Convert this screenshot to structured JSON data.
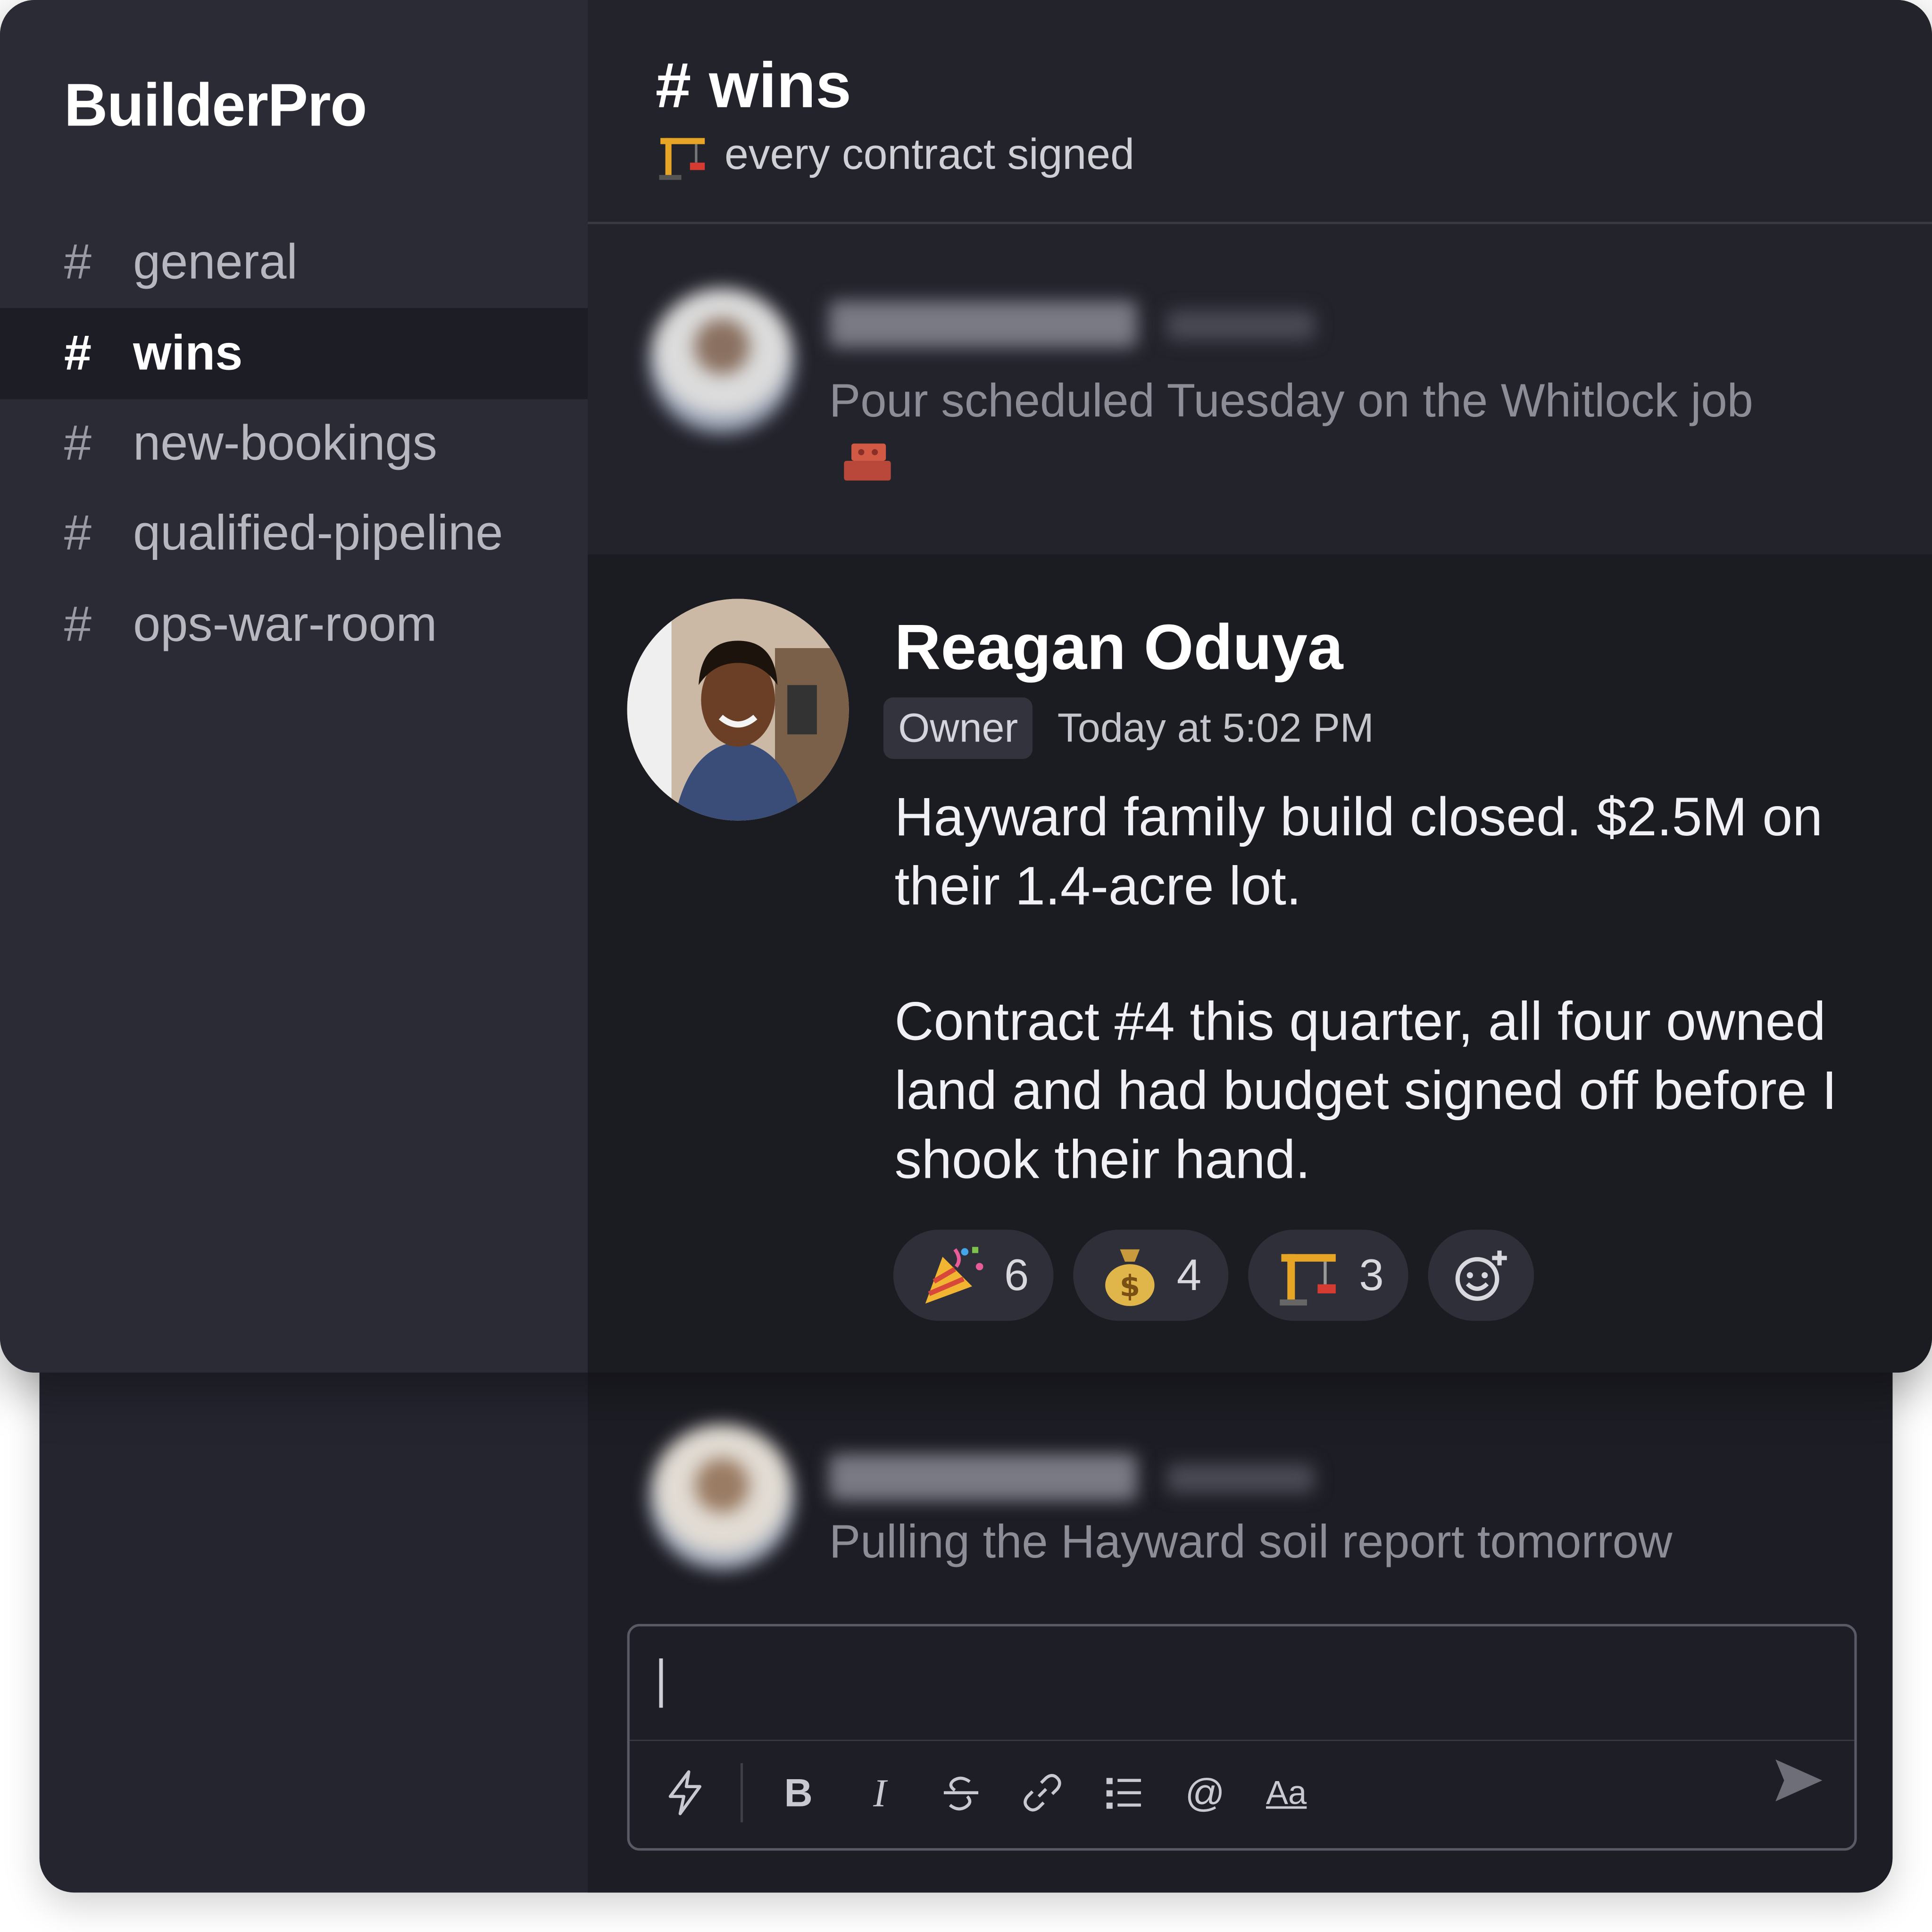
{
  "app": {
    "name": "BuilderPro"
  },
  "sidebar": {
    "channels": [
      {
        "label": "general",
        "active": false
      },
      {
        "label": "wins",
        "active": true
      },
      {
        "label": "new-bookings",
        "active": false
      },
      {
        "label": "qualified-pipeline",
        "active": false
      },
      {
        "label": "ops-war-room",
        "active": false
      }
    ],
    "hash_symbol": "#"
  },
  "channel": {
    "title": "# wins",
    "topic_icon": "construction-crane-icon",
    "topic": "every contract signed"
  },
  "messages": {
    "previous": {
      "text": "Pour scheduled Tuesday on the Whitlock job",
      "emoji_icon": "brick-icon"
    },
    "featured": {
      "author": "Reagan Oduya",
      "role": "Owner",
      "timestamp": "Today at 5:02 PM",
      "paragraph_1": "Hayward family build closed. $2.5M on their 1.4-acre lot.",
      "paragraph_2": "Contract #4 this quarter, all four owned land and had budget signed off before I shook their hand.",
      "reactions": [
        {
          "icon": "party-popper-icon",
          "count": "6"
        },
        {
          "icon": "money-bag-icon",
          "count": "4"
        },
        {
          "icon": "construction-crane-icon",
          "count": "3"
        }
      ]
    },
    "next": {
      "text": "Pulling the Hayward soil report tomorrow"
    }
  },
  "composer": {
    "value": "",
    "tools": [
      "lightning-icon",
      "bold-icon",
      "italic-icon",
      "strikethrough-icon",
      "link-icon",
      "numbered-list-icon",
      "mention-icon",
      "text-format-icon"
    ],
    "bold_label": "B",
    "italic_label": "I",
    "mention_label": "@",
    "format_label": "Aa"
  },
  "colors": {
    "sidebar_bg": "#2b2b35",
    "active_channel_bg": "#1d1d26",
    "main_bg": "#22222b",
    "featured_bg": "#1b1b22"
  }
}
